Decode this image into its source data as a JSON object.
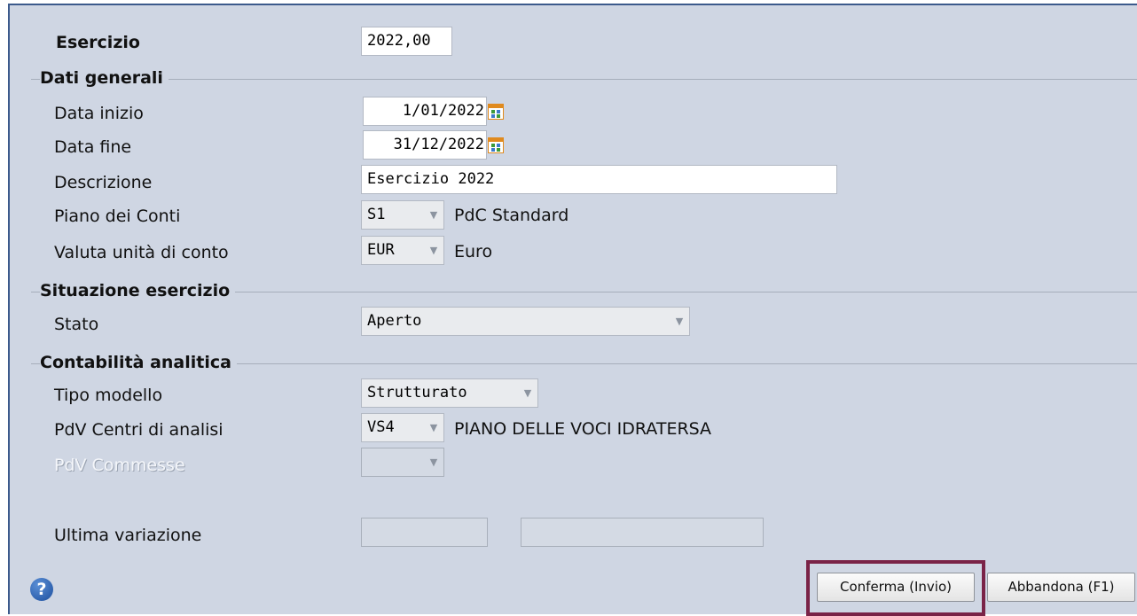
{
  "form": {
    "esercizio_label": "Esercizio",
    "esercizio_value": "2022,00"
  },
  "dati_generali": {
    "title": "Dati generali",
    "data_inizio_label": "Data inizio",
    "data_inizio_value": "1/01/2022",
    "data_fine_label": "Data fine",
    "data_fine_value": "31/12/2022",
    "descrizione_label": "Descrizione",
    "descrizione_value": "Esercizio 2022",
    "piano_conti_label": "Piano dei Conti",
    "piano_conti_code": "S1",
    "piano_conti_desc": "PdC Standard",
    "valuta_label": "Valuta unità di conto",
    "valuta_code": "EUR",
    "valuta_desc": "Euro"
  },
  "situazione": {
    "title": "Situazione esercizio",
    "stato_label": "Stato",
    "stato_value": "Aperto"
  },
  "analitica": {
    "title": "Contabilità analitica",
    "tipo_modello_label": "Tipo modello",
    "tipo_modello_value": "Strutturato",
    "pdv_centri_label": "PdV Centri di analisi",
    "pdv_centri_code": "VS4",
    "pdv_centri_desc": "PIANO DELLE VOCI IDRATERSA",
    "pdv_commesse_label": "PdV Commesse",
    "pdv_commesse_value": ""
  },
  "ultima_variazione": {
    "label": "Ultima variazione",
    "value1": "",
    "value2": ""
  },
  "footer": {
    "help_glyph": "?",
    "confirm_label": "Conferma (Invio)",
    "cancel_label": "Abbandona (F1)"
  },
  "icons": {
    "help": "help-icon",
    "calendar": "calendar-icon",
    "dropdown": "chevron-down-icon"
  },
  "colors": {
    "panel_bg": "#cfd6e3",
    "frame_border": "#3c5a8c",
    "highlight_border": "#7a2347"
  }
}
